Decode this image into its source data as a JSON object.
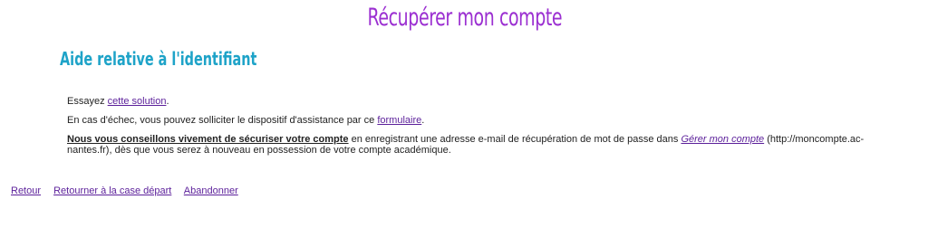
{
  "colors": {
    "title": "#9b2fd1",
    "subtitle": "#1ea3c8",
    "link": "#5b1f9a",
    "text": "#222222"
  },
  "header": {
    "title": "Récupérer mon compte",
    "subtitle": "Aide relative à l'identifiant"
  },
  "main": {
    "line1_prefix": "Essayez ",
    "line1_link": "cette solution",
    "line1_suffix": ".",
    "line2_prefix": "En cas d'échec, vous pouvez solliciter le dispositif d'assistance par ce ",
    "line2_link": "formulaire",
    "line2_suffix": ".",
    "line3_bold_link": "Nous vous conseillons vivement de sécuriser votre compte",
    "line3_mid": " en enregistrant une adresse e-mail de récupération de mot de passe dans ",
    "line3_italic_link": "Gérer mon compte",
    "line3_suffix": " (http://moncompte.ac-nantes.fr), dès que vous serez à nouveau en possession de votre compte académique."
  },
  "nav": {
    "back": "Retour",
    "start": "Retourner à la case départ",
    "abandon": "Abandonner"
  }
}
